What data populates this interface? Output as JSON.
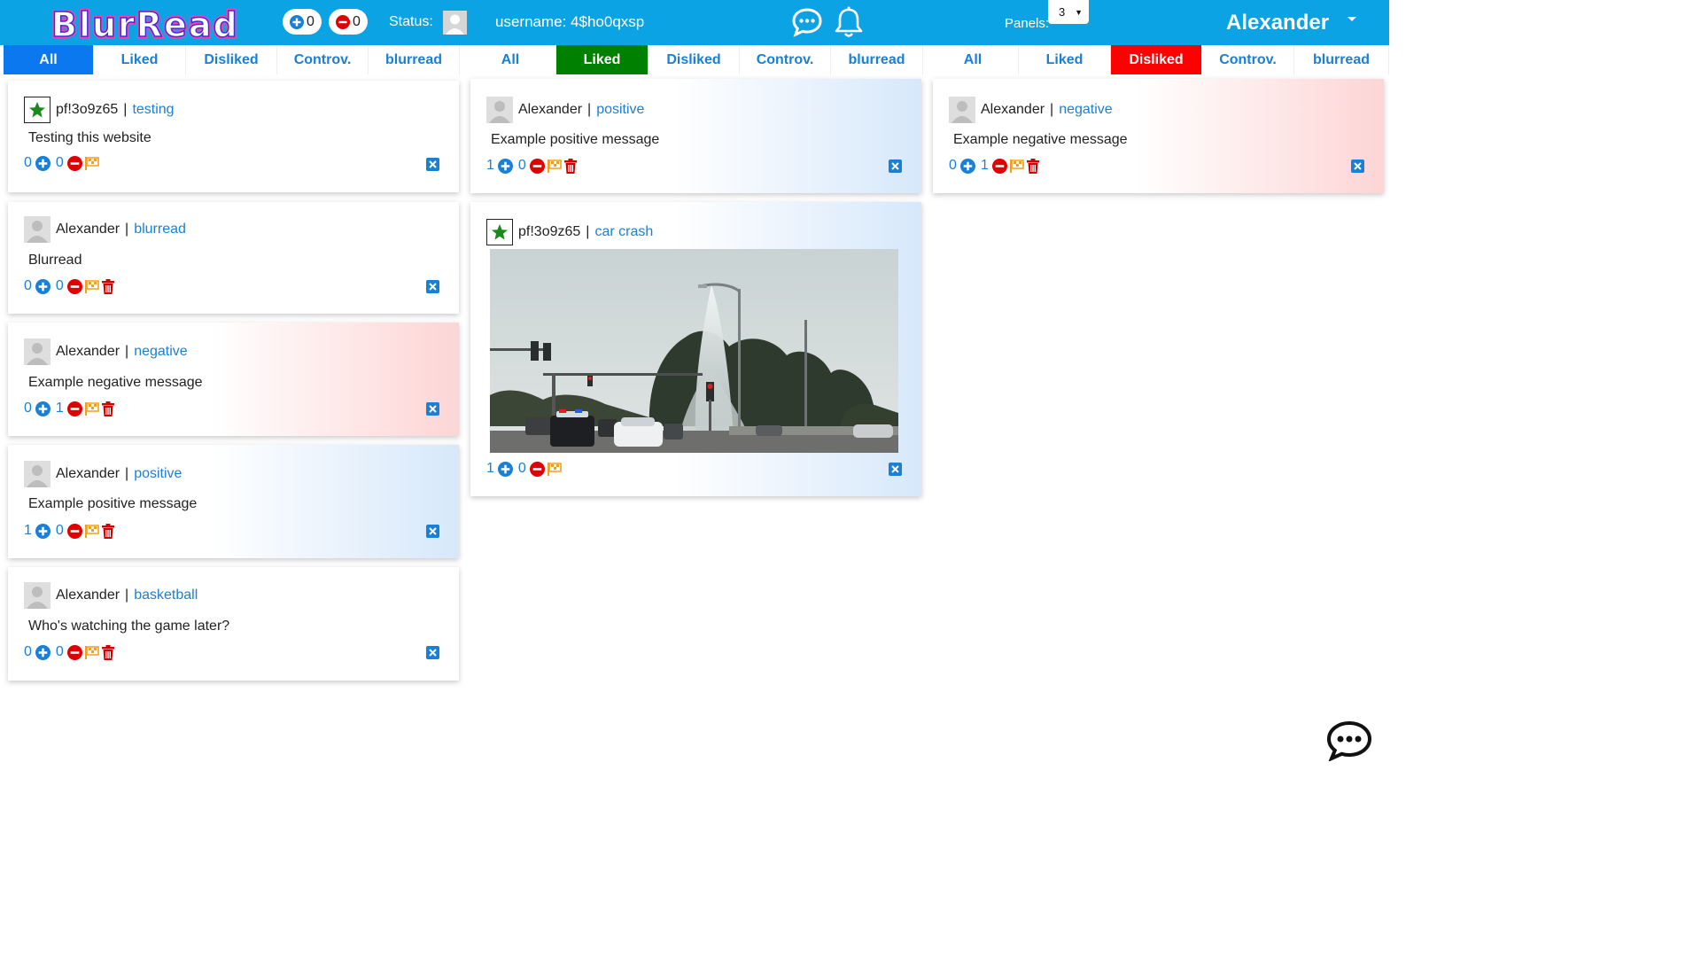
{
  "header": {
    "logo_text": "BlurRead",
    "likes_count": "0",
    "dislikes_count": "0",
    "status_label": "Status:",
    "username_label": "username: 4$ho0qxsp",
    "panels_label": "Panels:",
    "panels_value": "3",
    "user_name": "Alexander"
  },
  "icons": {
    "chat": "chat-bubble-icon",
    "bell": "bell-icon",
    "plus": "plus-circle-icon",
    "minus": "minus-circle-icon",
    "flag": "checkered-flag-icon",
    "trash": "trash-icon",
    "close": "close-x-icon",
    "star": "star-icon"
  },
  "colors": {
    "topbar": "#0ba3e3",
    "link": "#1a7fd6",
    "tab_all_active": "#0b78f0",
    "tab_liked_active": "#008000",
    "tab_disliked_active": "#ff0000",
    "star": "#1a8a1a",
    "minus": "#e00000",
    "flag": "#f0a020",
    "trash": "#d40000"
  },
  "panels": [
    {
      "tabs": [
        {
          "label": "All",
          "active": true
        },
        {
          "label": "Liked"
        },
        {
          "label": "Disliked"
        },
        {
          "label": "Controv."
        },
        {
          "label": "blurread"
        }
      ],
      "cards": [
        {
          "author": "pf!3o9z65",
          "sep": "|",
          "topic": "testing",
          "text": "Testing this website",
          "likes": "0",
          "dislikes": "0",
          "starred": true
        },
        {
          "author": "Alexander",
          "sep": "|",
          "topic": "blurread",
          "text": "Blurread",
          "likes": "0",
          "dislikes": "0"
        },
        {
          "author": "Alexander",
          "sep": "|",
          "topic": "negative",
          "text": "Example negative message",
          "likes": "0",
          "dislikes": "1"
        },
        {
          "author": "Alexander",
          "sep": "|",
          "topic": "positive",
          "text": "Example positive message",
          "likes": "1",
          "dislikes": "0"
        },
        {
          "author": "Alexander",
          "sep": "|",
          "topic": "basketball",
          "text": "Who's watching the game later?",
          "likes": "0",
          "dislikes": "0"
        }
      ]
    },
    {
      "tabs": [
        {
          "label": "All"
        },
        {
          "label": "Liked",
          "active": true
        },
        {
          "label": "Disliked"
        },
        {
          "label": "Controv."
        },
        {
          "label": "blurread"
        }
      ],
      "cards": [
        {
          "author": "Alexander",
          "sep": "|",
          "topic": "positive",
          "text": "Example positive message",
          "likes": "1",
          "dislikes": "0"
        },
        {
          "author": "pf!3o9z65",
          "sep": "|",
          "topic": "car crash",
          "likes": "1",
          "dislikes": "0",
          "starred": true
        }
      ]
    },
    {
      "tabs": [
        {
          "label": "All"
        },
        {
          "label": "Liked"
        },
        {
          "label": "Disliked",
          "active": true
        },
        {
          "label": "Controv."
        },
        {
          "label": "blurread"
        }
      ],
      "cards": [
        {
          "author": "Alexander",
          "sep": "|",
          "topic": "negative",
          "text": "Example negative message",
          "likes": "0",
          "dislikes": "1"
        }
      ]
    }
  ]
}
